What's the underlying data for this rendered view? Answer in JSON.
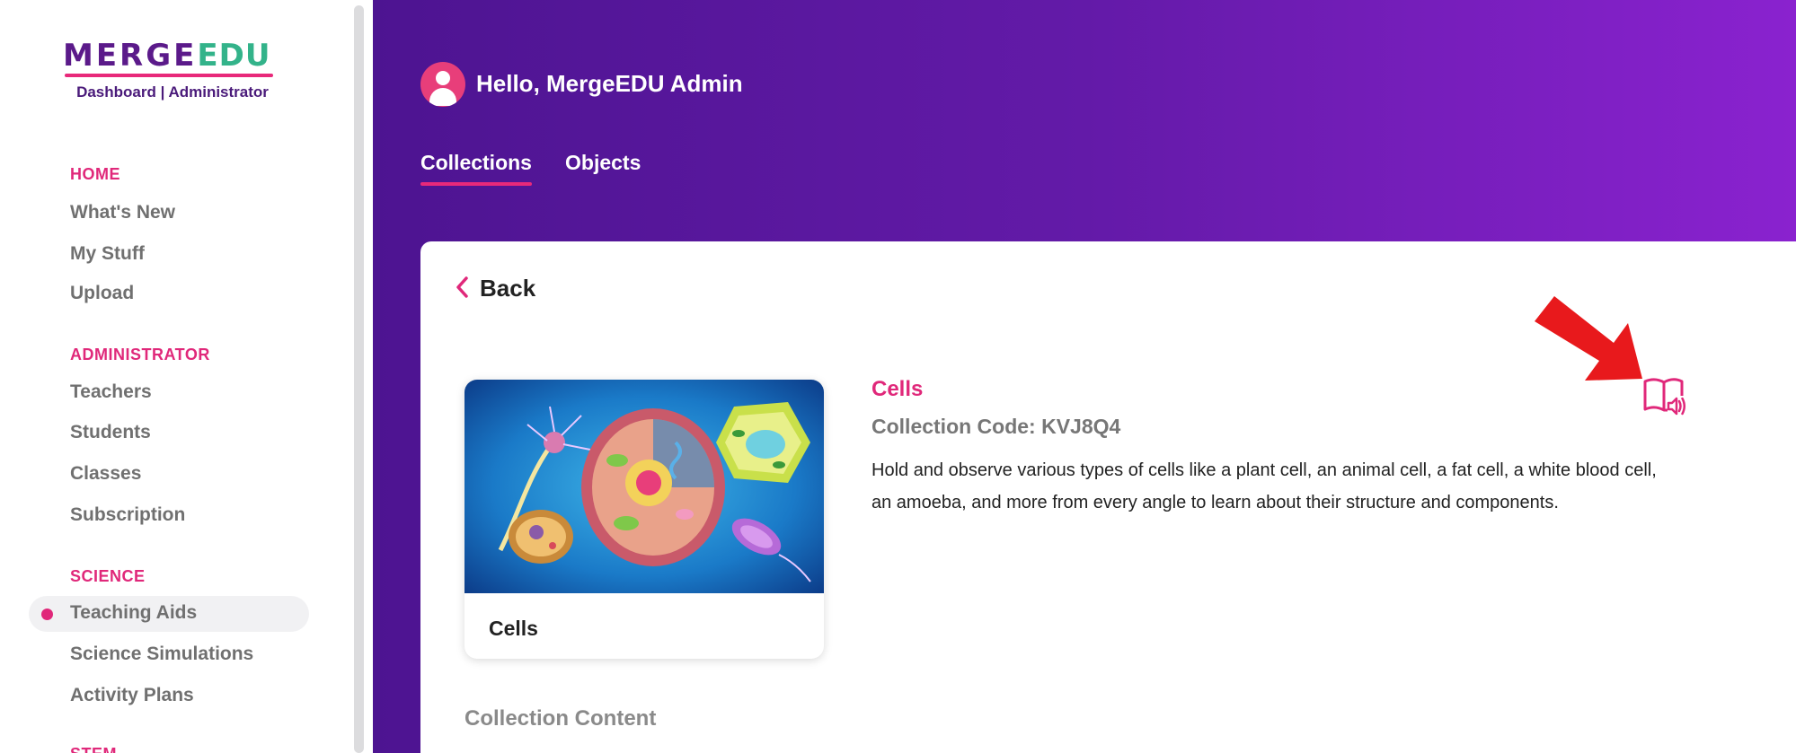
{
  "logo": {
    "brand": "MERGE",
    "brand_suffix": "EDU",
    "subtitle": "Dashboard | Administrator"
  },
  "sidebar": {
    "sections": [
      {
        "title": "HOME",
        "items": [
          "What's New",
          "My Stuff",
          "Upload"
        ]
      },
      {
        "title": "ADMINISTRATOR",
        "items": [
          "Teachers",
          "Students",
          "Classes",
          "Subscription"
        ]
      },
      {
        "title": "SCIENCE",
        "items": [
          "Teaching Aids",
          "Science Simulations",
          "Activity Plans"
        ]
      },
      {
        "title": "STEM",
        "items": []
      }
    ],
    "active_item": "Teaching Aids"
  },
  "header": {
    "greeting": "Hello, MergeEDU Admin",
    "tabs": [
      {
        "label": "Collections",
        "active": true
      },
      {
        "label": "Objects",
        "active": false
      }
    ]
  },
  "content": {
    "back_label": "Back",
    "thumbnail_label": "Cells",
    "collection_title": "Cells",
    "collection_code": "Collection Code: KVJ8Q4",
    "description": "Hold and observe various types of cells like a plant cell, an animal cell, a fat cell, a white blood cell, an amoeba, and more from every angle to learn about their structure and components.",
    "section_heading": "Collection Content",
    "read_aloud_icon": "book-audio-icon",
    "annotation": "red-arrow-pointer"
  },
  "colors": {
    "accent": "#e0287a",
    "header_gradient_start": "#4d1491",
    "header_gradient_end": "#8a22cf",
    "logo_purple": "#5b1a8a",
    "logo_green": "#33b38a"
  }
}
